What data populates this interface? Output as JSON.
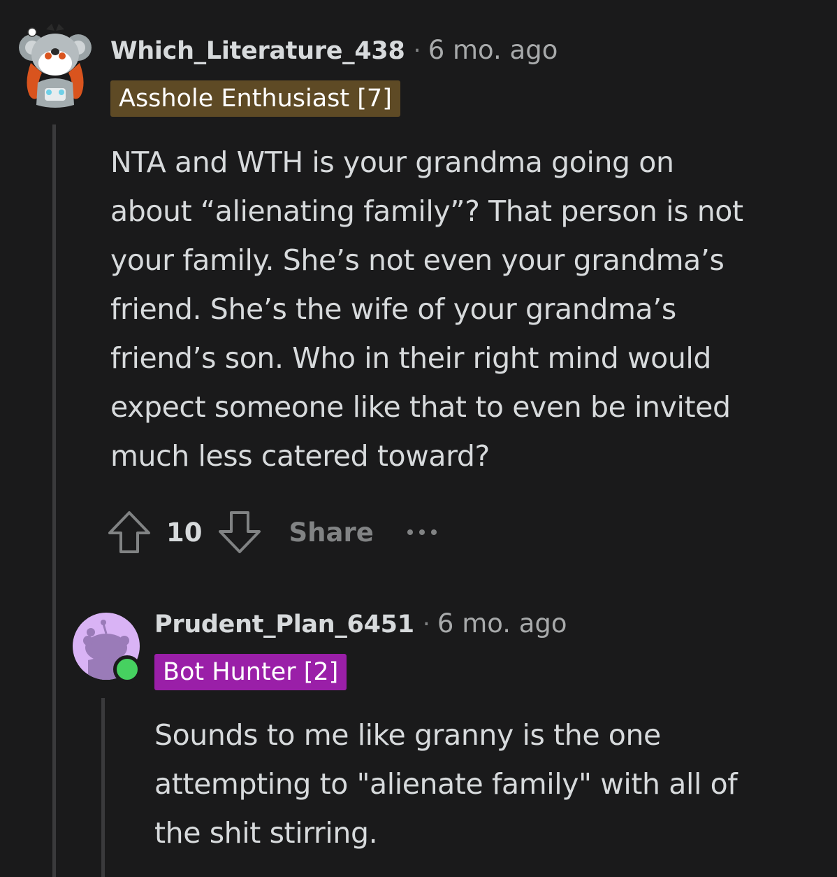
{
  "comments": [
    {
      "username": "Which_Literature_438",
      "separator": "·",
      "timestamp": "6 mo. ago",
      "flair": "Asshole Enthusiast [7]",
      "flair_color": "#5e4a25",
      "body_lines": [
        "NTA and WTH is your grandma going on",
        "about “alienating family”? That person is not",
        "your family. She’s not even your grandma’s",
        "friend. She’s the wife of your grandma’s",
        "friend’s son. Who in their right mind would",
        "expect someone like that to even be invited",
        "much less catered toward?"
      ],
      "score": "10",
      "share_label": "Share",
      "icons": [
        "upvote-icon",
        "downvote-icon",
        "more-options-icon"
      ]
    },
    {
      "username": "Prudent_Plan_6451",
      "separator": "·",
      "timestamp": "6 mo. ago",
      "flair": "Bot Hunter [2]",
      "flair_color": "#9a1fa8",
      "online": true,
      "body_lines": [
        "Sounds to me like granny is the one",
        "attempting to \"alienate family\" with all of",
        "the shit stirring."
      ]
    }
  ],
  "colors": {
    "background": "#1a1a1b",
    "text": "#d7dadc",
    "muted": "#818384",
    "online": "#46d160"
  }
}
